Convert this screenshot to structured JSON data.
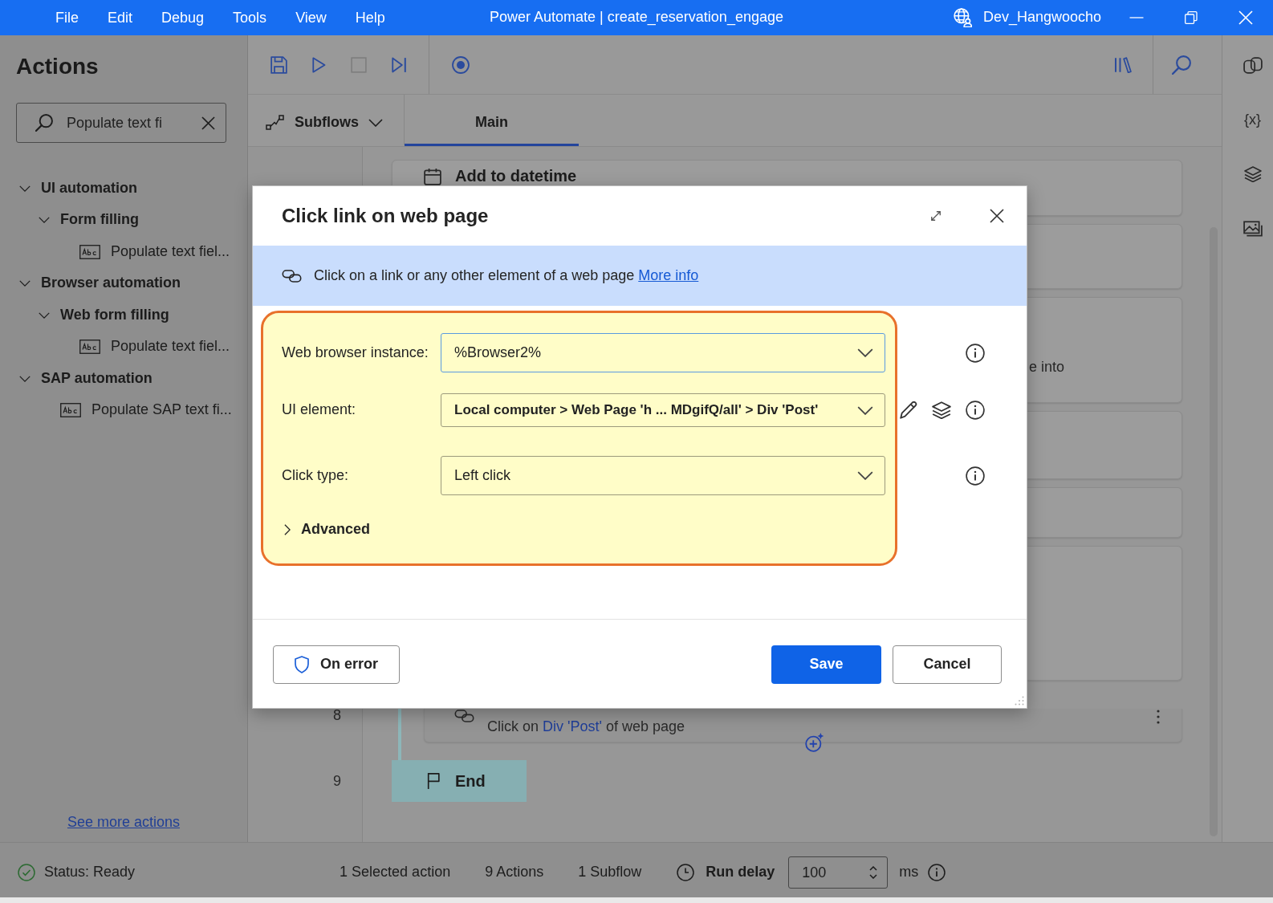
{
  "window": {
    "title": "Power Automate | create_reservation_engage",
    "user": "Dev_Hangwoocho"
  },
  "menu": [
    "File",
    "Edit",
    "Debug",
    "Tools",
    "View",
    "Help"
  ],
  "actions_panel": {
    "title": "Actions",
    "search": {
      "value": "Populate text fi"
    },
    "tree": [
      {
        "label": "UI automation",
        "expanded": true,
        "children": [
          {
            "label": "Form filling",
            "expanded": true,
            "children": [
              {
                "label": "Populate text fiel..."
              }
            ]
          }
        ]
      },
      {
        "label": "Browser automation",
        "expanded": true,
        "children": [
          {
            "label": "Web form filling",
            "expanded": true,
            "children": [
              {
                "label": "Populate text fiel..."
              }
            ]
          }
        ]
      },
      {
        "label": "SAP automation",
        "expanded": true,
        "children": [
          {
            "label": "Populate SAP text fi..."
          }
        ]
      }
    ],
    "more_link": "See more actions"
  },
  "toolbar": {
    "groups": [
      [
        {
          "kind": "save",
          "disabled": false
        },
        {
          "kind": "run",
          "disabled": false
        },
        {
          "kind": "stop",
          "disabled": true
        },
        {
          "kind": "run-next",
          "disabled": false
        }
      ],
      [
        {
          "kind": "record",
          "disabled": false
        }
      ]
    ]
  },
  "tabs": [
    {
      "kind": "dropdown",
      "label": "Subflows",
      "selected": false
    },
    {
      "kind": "tab",
      "label": "Main",
      "selected": true
    }
  ],
  "side_rail": {
    "variables_label": "{x}"
  },
  "canvas": {
    "steps": [
      {
        "kind": "action",
        "title": "Add to datetime"
      },
      {
        "kind": "covered"
      },
      {
        "kind": "covered",
        "fragment": "e into"
      },
      {
        "kind": "covered"
      },
      {
        "kind": "covered"
      },
      {
        "kind": "covered"
      },
      {
        "kind": "nested-action",
        "number": "8",
        "description": {
          "before": "Click on",
          "value": "Div 'Post'",
          "after": "of web page"
        }
      },
      {
        "kind": "end",
        "number": "9",
        "title": "End"
      }
    ]
  },
  "dialog": {
    "title": "Click link on web page",
    "description": "Click on a link or any other element of a web page",
    "more_info": "More info",
    "highlighted": true,
    "fields": [
      {
        "kind": "dropdown",
        "label": "Web browser instance:",
        "value": "%Browser2%",
        "focused": true
      },
      {
        "kind": "element-picker",
        "label": "UI element:",
        "value": "Local computer > Web Page 'h ... MDgifQ/all' > Div 'Post'",
        "focused": false
      },
      {
        "kind": "dropdown",
        "label": "Click type:",
        "value": "Left click",
        "focused": false
      }
    ],
    "advanced": {
      "label": "Advanced",
      "expanded": false
    },
    "buttons": [
      {
        "kind": "on-error",
        "label": "On error"
      },
      {
        "kind": "primary",
        "label": "Save"
      },
      {
        "kind": "secondary",
        "label": "Cancel"
      }
    ]
  },
  "status_bar": {
    "status": "Status: Ready",
    "counts": [
      "1 Selected action",
      "9 Actions",
      "1 Subflow"
    ],
    "run_delay": {
      "label": "Run delay",
      "value": "100",
      "unit": "ms"
    }
  }
}
